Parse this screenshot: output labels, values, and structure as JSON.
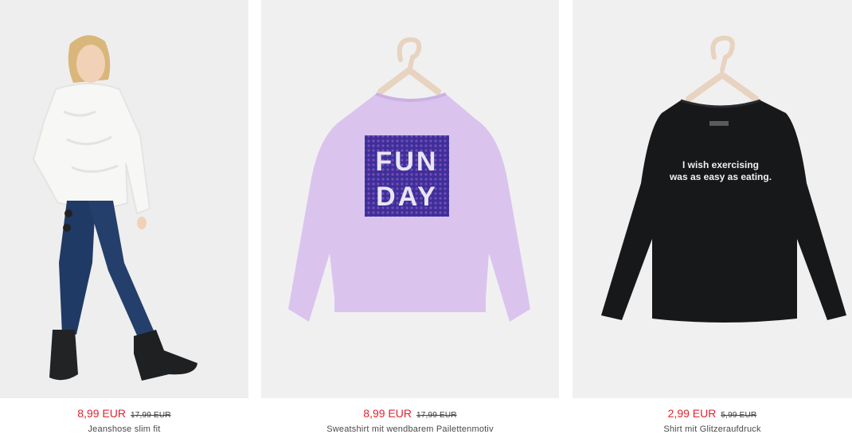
{
  "products": [
    {
      "image_label": "Jeanshose slim fit model photo",
      "price": "8,99 EUR",
      "old_price": "17,99 EUR",
      "name": "Jeanshose slim fit"
    },
    {
      "image_label": "Sweatshirt product photo",
      "graphic_line1": "FUN",
      "graphic_line2": "DAY",
      "price": "8,99 EUR",
      "old_price": "17,99 EUR",
      "name": "Sweatshirt mit wendbarem Pailettenmotiv"
    },
    {
      "image_label": "Shirt product photo",
      "print_line1": "I wish exercising",
      "print_line2": "was as easy as eating.",
      "price": "2,99 EUR",
      "old_price": "5,99 EUR",
      "name": "Shirt mit Glitzeraufdruck"
    }
  ],
  "colors": {
    "sale_price": "#e0242f",
    "image_bg": "#f0f0f1"
  }
}
